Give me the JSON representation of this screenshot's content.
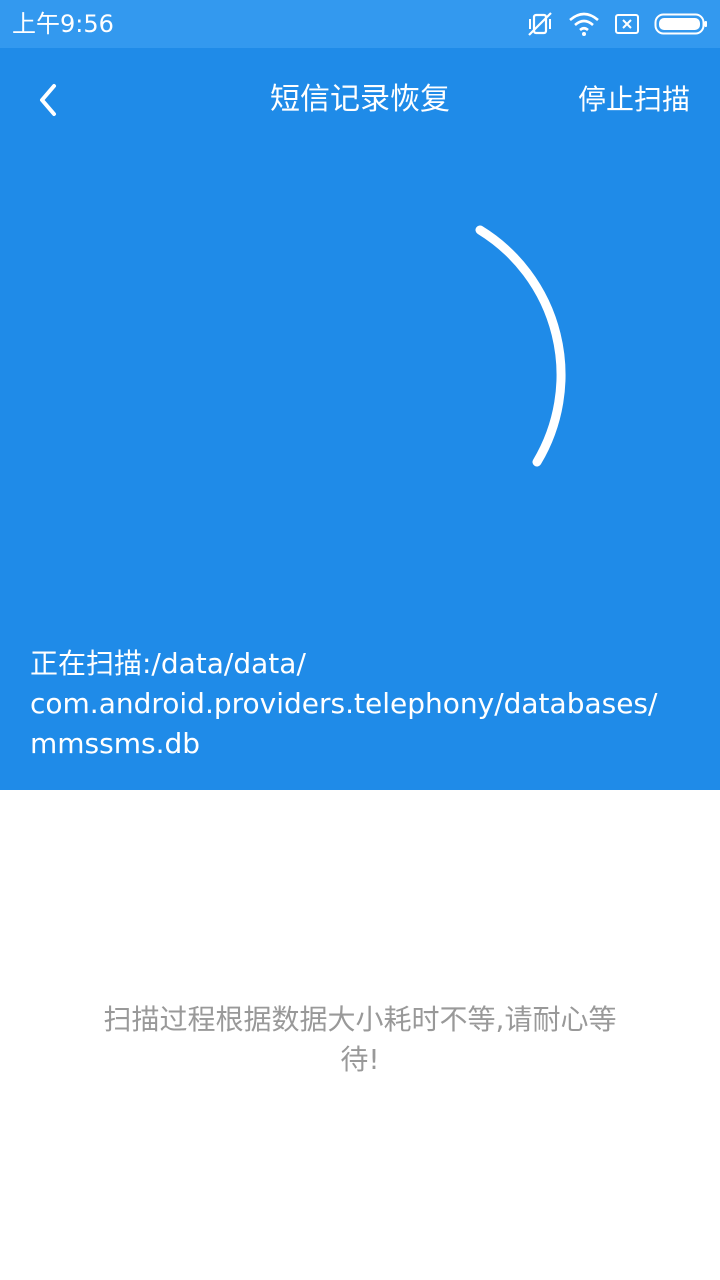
{
  "status_bar": {
    "time": "上午9:56",
    "icons": [
      "vibrate-off-icon",
      "wifi-icon",
      "sim-x-icon",
      "battery-icon"
    ]
  },
  "toolbar": {
    "back_icon": "chevron-left-icon",
    "title": "短信记录恢复",
    "stop_label": "停止扫描"
  },
  "scan": {
    "line1": "正在扫描:/data/data/",
    "line2": "com.android.providers.telephony/databases/",
    "line3": "mmssms.db"
  },
  "message": {
    "line1": "扫描过程根据数据大小耗时不等,请耐心等",
    "line2": "待!"
  },
  "colors": {
    "status_bar": "#3399ef",
    "primary": "#1f8be8",
    "white": "#ffffff",
    "hint_text": "#999999"
  }
}
